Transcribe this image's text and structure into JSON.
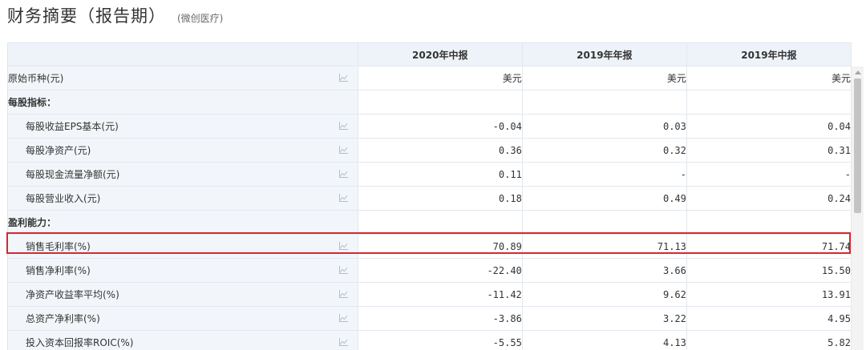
{
  "header": {
    "title": "财务摘要（报告期）",
    "company": "(微创医疗)"
  },
  "table": {
    "columns": [
      "2020年中报",
      "2019年年报",
      "2019年中报"
    ],
    "rows": [
      {
        "label": "原始币种(元)",
        "values": [
          "美元",
          "美元",
          "美元"
        ],
        "kind": "data",
        "indent": false
      },
      {
        "label": "每股指标：",
        "values": [
          "",
          "",
          ""
        ],
        "kind": "section",
        "indent": false
      },
      {
        "label": "每股收益EPS基本(元)",
        "values": [
          "-0.04",
          "0.03",
          "0.04"
        ],
        "kind": "data",
        "indent": true
      },
      {
        "label": "每股净资产(元)",
        "values": [
          "0.36",
          "0.32",
          "0.31"
        ],
        "kind": "data",
        "indent": true
      },
      {
        "label": "每股现金流量净额(元)",
        "values": [
          "0.11",
          "-",
          "-"
        ],
        "kind": "data",
        "indent": true
      },
      {
        "label": "每股营业收入(元)",
        "values": [
          "0.18",
          "0.49",
          "0.24"
        ],
        "kind": "data",
        "indent": true
      },
      {
        "label": "盈利能力：",
        "values": [
          "",
          "",
          ""
        ],
        "kind": "section",
        "indent": false
      },
      {
        "label": "销售毛利率(%)",
        "values": [
          "70.89",
          "71.13",
          "71.74"
        ],
        "kind": "data",
        "indent": true,
        "highlighted": true
      },
      {
        "label": "销售净利率(%)",
        "values": [
          "-22.40",
          "3.66",
          "15.50"
        ],
        "kind": "data",
        "indent": true
      },
      {
        "label": "净资产收益率平均(%)",
        "values": [
          "-11.42",
          "9.62",
          "13.91"
        ],
        "kind": "data",
        "indent": true
      },
      {
        "label": "总资产净利率(%)",
        "values": [
          "-3.86",
          "3.22",
          "4.95"
        ],
        "kind": "data",
        "indent": true
      },
      {
        "label": "投入资本回报率ROIC(%)",
        "values": [
          "-5.55",
          "4.13",
          "5.82"
        ],
        "kind": "data",
        "indent": true
      }
    ]
  },
  "colors": {
    "highlight_border": "#d9262e",
    "header_bg": "#eef3f9",
    "label_bg": "#f2f6fa",
    "icon_color": "#a9bfd6"
  },
  "icons": {
    "row_action": "line-chart-icon"
  }
}
